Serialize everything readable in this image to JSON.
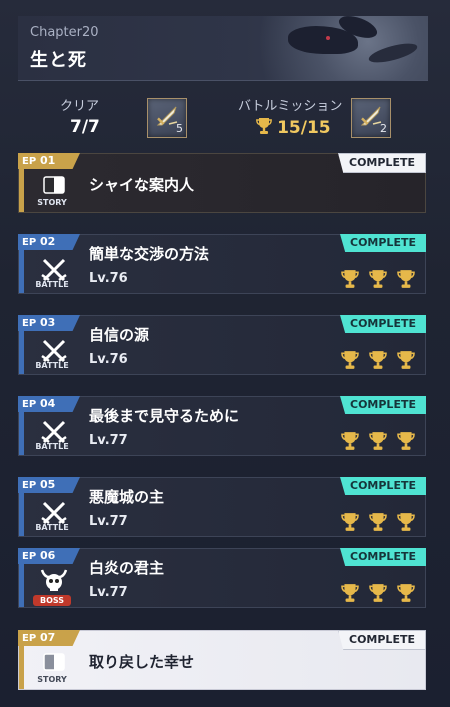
{
  "header": {
    "chapter_label": "Chapter20",
    "chapter_title": "生と死"
  },
  "stats": {
    "clear_label": "クリア",
    "clear_value": "7/7",
    "clear_reward_count": "5",
    "mission_label": "バトルミッション",
    "mission_value": "15/15",
    "mission_reward_count": "2"
  },
  "episodes": [
    {
      "ep": "EP",
      "num": "01",
      "type": "STORY",
      "title": "シャイな案内人",
      "level": "",
      "status": "COMPLETE",
      "trophies": 0
    },
    {
      "ep": "EP",
      "num": "02",
      "type": "BATTLE",
      "title": "簡単な交渉の方法",
      "level": "Lv.76",
      "status": "COMPLETE",
      "trophies": 3
    },
    {
      "ep": "EP",
      "num": "03",
      "type": "BATTLE",
      "title": "自信の源",
      "level": "Lv.76",
      "status": "COMPLETE",
      "trophies": 3
    },
    {
      "ep": "EP",
      "num": "04",
      "type": "BATTLE",
      "title": "最後まで見守るために",
      "level": "Lv.77",
      "status": "COMPLETE",
      "trophies": 3
    },
    {
      "ep": "EP",
      "num": "05",
      "type": "BATTLE",
      "title": "悪魔城の主",
      "level": "Lv.77",
      "status": "COMPLETE",
      "trophies": 3
    },
    {
      "ep": "EP",
      "num": "06",
      "type": "BOSS",
      "title": "白炎の君主",
      "level": "Lv.77",
      "status": "COMPLETE",
      "trophies": 3
    },
    {
      "ep": "EP",
      "num": "07",
      "type": "STORY",
      "title": "取り戻した幸せ",
      "level": "",
      "status": "COMPLETE",
      "trophies": 0
    }
  ],
  "colors": {
    "story_gold": "#c9a24a",
    "battle_blue": "#3f6fb7",
    "boss_red": "#c0392b",
    "complete_teal": "#4fe3d2",
    "trophy_gold": "#e6b84a"
  }
}
